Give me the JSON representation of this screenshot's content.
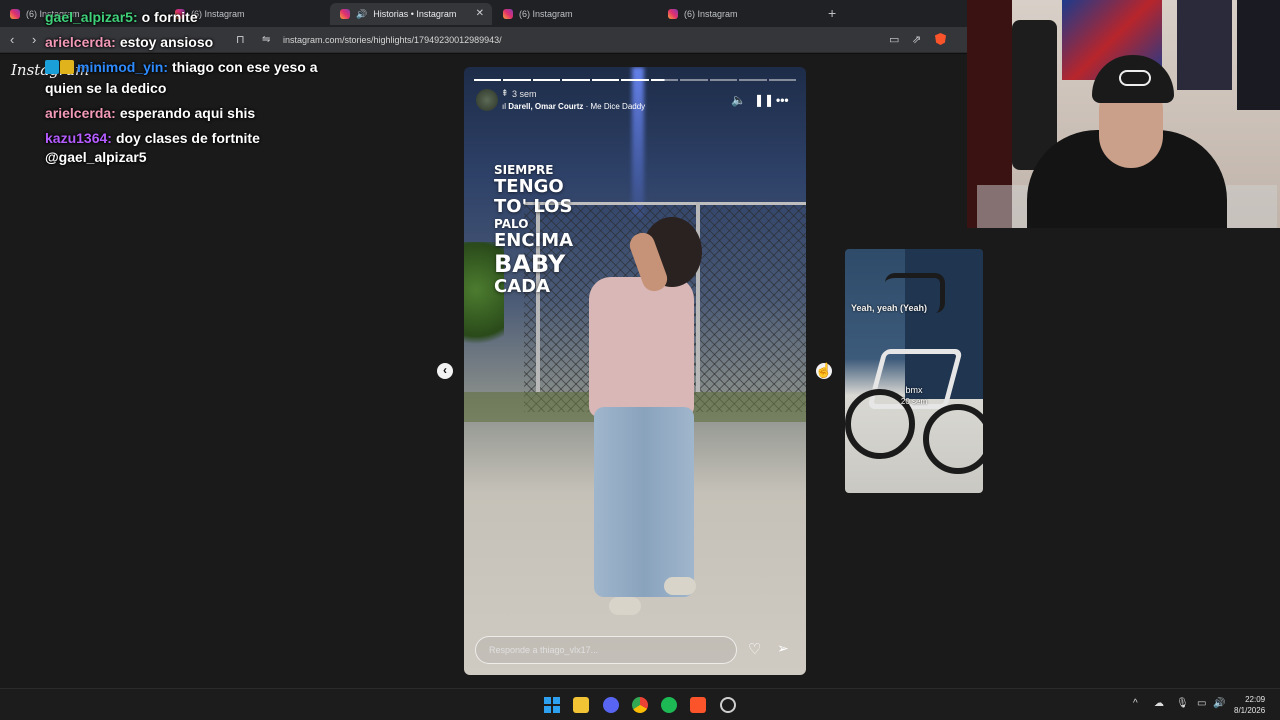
{
  "browser": {
    "tabs": [
      {
        "label": "(6) Instagram",
        "active": false
      },
      {
        "label": "(6) Instagram",
        "active": false
      },
      {
        "label": "Historias • Instagram",
        "active": true
      },
      {
        "label": "(6) Instagram",
        "active": false
      },
      {
        "label": "(6) Instagram",
        "active": false
      }
    ],
    "new_tab": "+",
    "close": "✕",
    "url": "instagram.com/stories/highlights/17949230012989943/"
  },
  "instagram": {
    "logo": "Instagram"
  },
  "chat": [
    {
      "user": "gael_alpizar5:",
      "text": "o fornite",
      "color": "#3fd07a"
    },
    {
      "user": "arielcerda:",
      "text": "estoy ansioso",
      "color": "#f39ab8"
    },
    {
      "user": "minimod_yin:",
      "text": "thiago con ese yeso a quien se la dedico",
      "color": "#2e8bff"
    },
    {
      "user": "arielcerda:",
      "text": "esperando aqui shis",
      "color": "#f39ab8"
    },
    {
      "user": "kazu1364:",
      "text": "doy clases de fortnite @gael_alpizar5",
      "color": "#b45cff"
    }
  ],
  "story": {
    "time": "3 sem",
    "music": {
      "artists": "Darell, Omar Courtz",
      "sep": " · ",
      "song": "Me Dice Daddy"
    },
    "lyrics": [
      {
        "text": "SIEMPRE",
        "size": "s"
      },
      {
        "text": "TENGO",
        "size": "m"
      },
      {
        "text": "TO' LOS",
        "size": "m"
      },
      {
        "text": "PALO",
        "size": "s"
      },
      {
        "text": "ENCIMA",
        "size": "m"
      },
      {
        "text": "BABY",
        "size": "l"
      },
      {
        "text": "CADA",
        "size": "m"
      }
    ],
    "reply_placeholder": "Responde a thiago_vlx17...",
    "segments_total": 11,
    "segments_done": 6
  },
  "next_preview": {
    "caption": "Yeah, yeah (Yeah)",
    "title": "bmx",
    "time": "20 sem"
  },
  "taskbar": {
    "time": "22:09",
    "date": "8/1/2026"
  },
  "colors": {
    "accent": "#e1306c",
    "windows_blue": "#2ea0f0"
  }
}
